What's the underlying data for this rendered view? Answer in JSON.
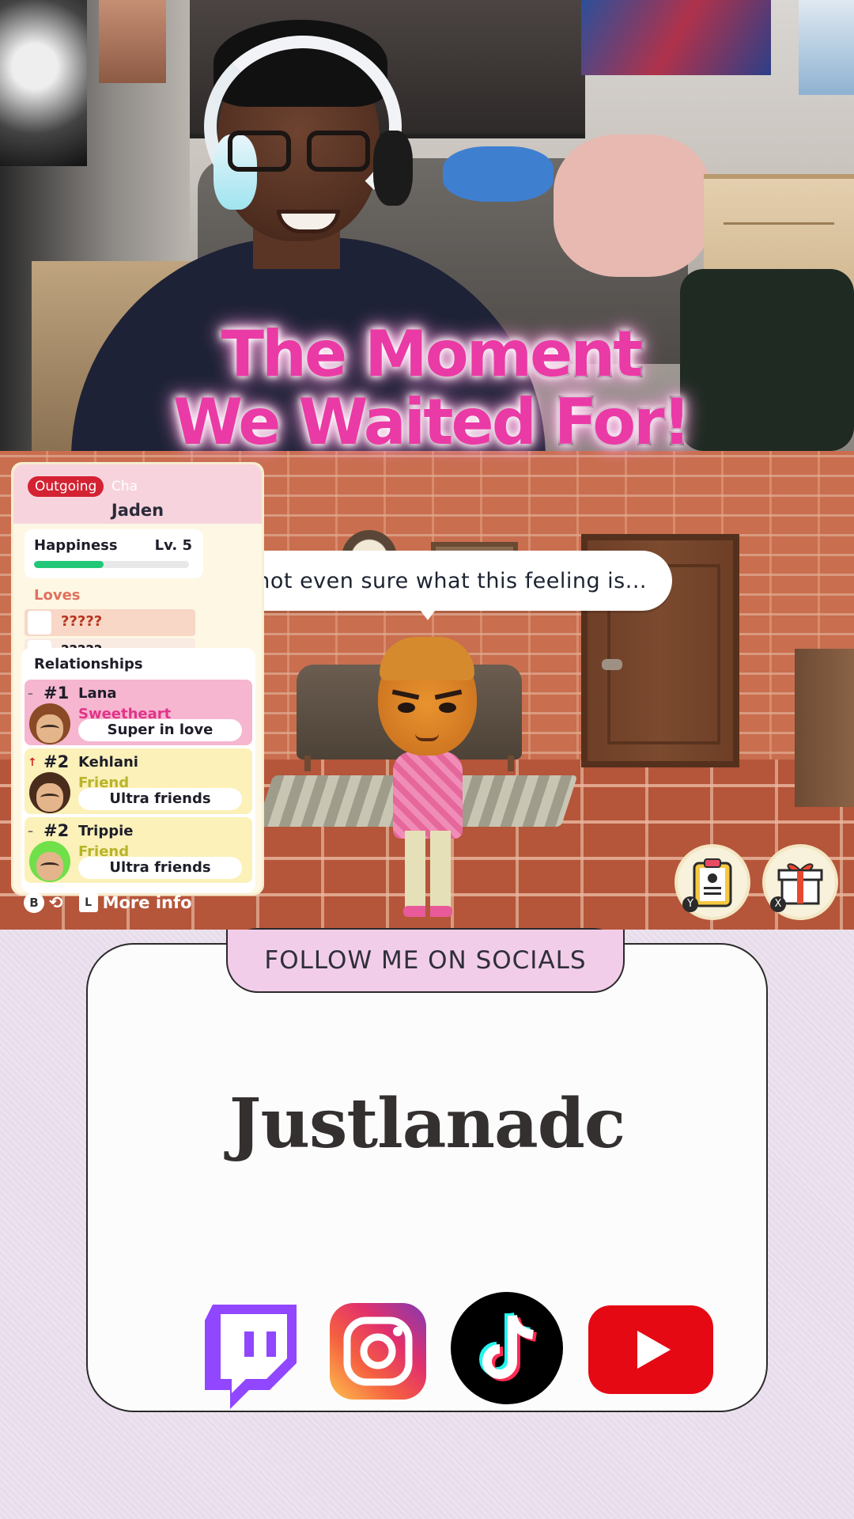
{
  "overlay": {
    "title_line1": "The Moment",
    "title_line2": "We Waited For!"
  },
  "game": {
    "speech": "I'm not even sure what this feeling is...",
    "panel": {
      "tag_outgoing": "Outgoing",
      "tag_partial": "Cha",
      "name": "Jaden",
      "happiness_label": "Happiness",
      "happiness_level": "Lv. 5",
      "happiness_progress": 0.45,
      "loves_label": "Loves",
      "loves": [
        "?????",
        "?????"
      ],
      "relationships_label": "Relationships",
      "relationships": [
        {
          "trend": "–",
          "rank": "#1",
          "name": "Lana",
          "type": "Sweetheart",
          "status": "Super in love"
        },
        {
          "trend": "↑",
          "rank": "#2",
          "name": "Kehlani",
          "type": "Friend",
          "status": "Ultra friends"
        },
        {
          "trend": "–",
          "rank": "#2",
          "name": "Trippie",
          "type": "Friend",
          "status": "Ultra friends"
        }
      ]
    },
    "controls": {
      "back_button": "B",
      "more_info_button": "L",
      "more_info_label": "More info",
      "y_label": "Y",
      "x_label": "X"
    },
    "colors": {
      "happiness_bar": "#22c777",
      "sweetheart": "#e0358a",
      "friend": "#b8b42a"
    }
  },
  "socials": {
    "follow_label": "FOLLOW ME ON SOCIALS",
    "handle": "Justlanadc",
    "icons": [
      "twitch-icon",
      "instagram-icon",
      "tiktok-icon",
      "youtube-icon"
    ]
  }
}
